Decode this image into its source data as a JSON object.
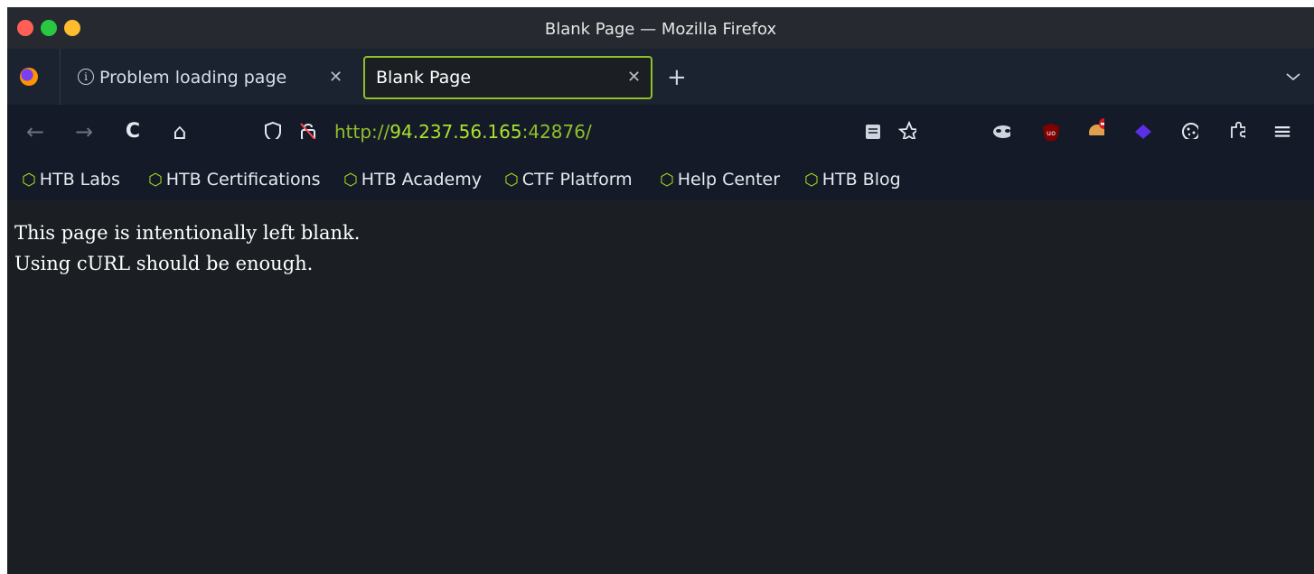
{
  "window": {
    "title": "Blank Page — Mozilla Firefox"
  },
  "tabs": [
    {
      "label": "Problem loading page",
      "icon": "info-icon",
      "active": false
    },
    {
      "label": "Blank Page",
      "active": true
    }
  ],
  "toolbar": {
    "back_icon": "←",
    "forward_icon": "→",
    "reload_icon": "C",
    "home_icon": "⌂",
    "new_tab_icon": "+",
    "tab_list_icon": "⌄",
    "menu_icon": "≡"
  },
  "address_bar": {
    "scheme": "http://",
    "host": "94.237.56.165",
    "port_path": ":42876/"
  },
  "bookmarks": [
    "HTB Labs",
    "HTB Certifications",
    "HTB Academy",
    "CTF Platform",
    "Help Center",
    "HTB Blog"
  ],
  "page": {
    "lines": [
      "This page is intentionally left blank.",
      "Using cURL should be enough."
    ]
  },
  "colors": {
    "accent": "#8fc02a",
    "background": "#1b1f23",
    "toolbar": "#151a28"
  }
}
